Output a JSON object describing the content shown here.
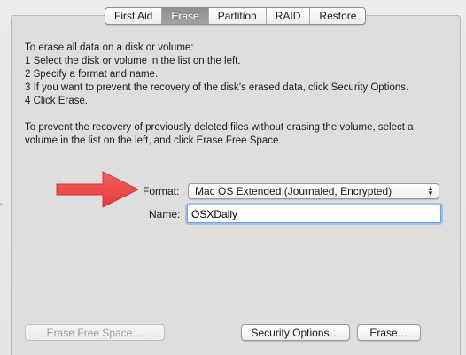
{
  "tabs": [
    {
      "label": "First Aid",
      "active": false
    },
    {
      "label": "Erase",
      "active": true
    },
    {
      "label": "Partition",
      "active": false
    },
    {
      "label": "RAID",
      "active": false
    },
    {
      "label": "Restore",
      "active": false
    }
  ],
  "instructions": {
    "intro": "To erase all data on a disk or volume:",
    "step1": "1  Select the disk or volume in the list on the left.",
    "step2": "2  Specify a format and name.",
    "step3": "3  If you want to prevent the recovery of the disk’s erased data, click Security Options.",
    "step4": "4  Click Erase.",
    "free_space": "To prevent the recovery of previously deleted files without erasing the volume, select a volume in the list on the left, and click Erase Free Space."
  },
  "form": {
    "format_label": "Format:",
    "format_value": "Mac OS Extended (Journaled, Encrypted)",
    "name_label": "Name:",
    "name_value": "OSXDaily"
  },
  "buttons": {
    "erase_free_space": "Erase Free Space…",
    "security_options": "Security Options…",
    "erase": "Erase…"
  },
  "colors": {
    "arrow": "#f2494a",
    "focus_ring": "#9ec1ea",
    "active_tab": "#999999"
  }
}
